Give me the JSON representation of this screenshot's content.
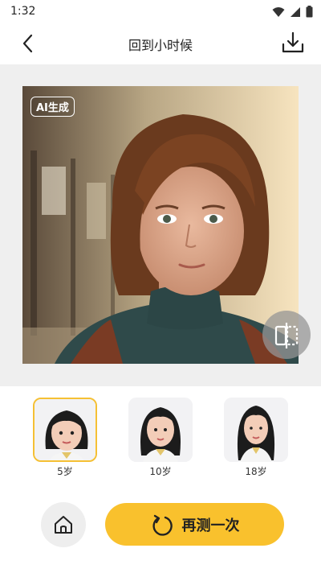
{
  "status_bar": {
    "time": "1:32",
    "icons": [
      "wifi-icon",
      "signal-icon",
      "battery-icon"
    ]
  },
  "header": {
    "title": "回到小时候",
    "back_icon": "chevron-left-icon",
    "download_icon": "download-icon"
  },
  "preview": {
    "badge": "AI生成",
    "compare_icon": "compare-icon"
  },
  "age_options": [
    {
      "label": "5岁",
      "selected": true
    },
    {
      "label": "10岁",
      "selected": false
    },
    {
      "label": "18岁",
      "selected": false
    }
  ],
  "bottom": {
    "home_icon": "home-icon",
    "retest_label": "再测一次",
    "retest_icon": "refresh-icon"
  },
  "colors": {
    "accent": "#f9c12d",
    "selected_border": "#f5c034",
    "panel_bg": "#efefef"
  }
}
